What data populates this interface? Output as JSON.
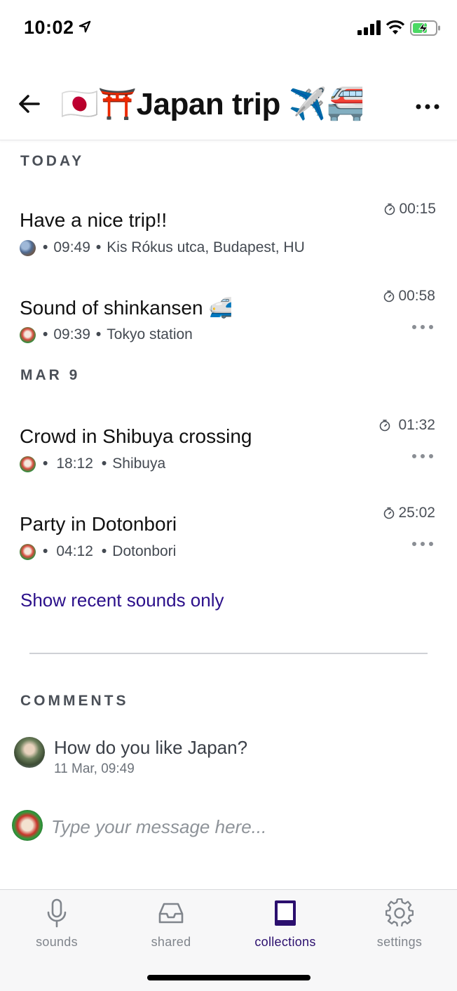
{
  "status_bar": {
    "time": "10:02",
    "battery_charging": true,
    "colors": {
      "battery_fill": "#4cd964"
    }
  },
  "header": {
    "title_flags_left": "🇯🇵⛩️",
    "title_text": "Japan trip",
    "title_flags_right": "✈️🚝",
    "back_icon": "back-arrow-icon",
    "more_icon": "more-horizontal-icon"
  },
  "sections": {
    "today_label": "TODAY",
    "mar9_label": "MAR 9",
    "comments_label": "COMMENTS"
  },
  "sounds": [
    {
      "title": "Have a nice trip!!",
      "time": "09:49",
      "location": "Kis Rókus utca, Budapest, HU",
      "duration": "00:15",
      "has_more": false
    },
    {
      "title": "Sound of shinkansen 🚅",
      "time": "09:39",
      "location": "Tokyo station",
      "duration": "00:58",
      "has_more": true
    },
    {
      "title": "Crowd in Shibuya crossing",
      "time": "18:12",
      "location": "Shibuya",
      "duration": "01:32",
      "has_more": true
    },
    {
      "title": "Party in Dotonbori",
      "time": "04:12",
      "location": "Dotonbori",
      "duration": "25:02",
      "has_more": true
    }
  ],
  "show_recent_link": "Show recent sounds only",
  "comments": [
    {
      "text": "How do you like Japan?",
      "timestamp": "11 Mar, 09:49"
    }
  ],
  "composer": {
    "placeholder": "Type your message here..."
  },
  "tabs": [
    {
      "label": "sounds",
      "icon": "microphone-icon",
      "active": false
    },
    {
      "label": "shared",
      "icon": "inbox-icon",
      "active": false
    },
    {
      "label": "collections",
      "icon": "book-icon",
      "active": true
    },
    {
      "label": "settings",
      "icon": "gear-icon",
      "active": false
    }
  ],
  "colors": {
    "accent": "#2b0f6e",
    "link": "#2b0f8a",
    "muted": "#80858c"
  }
}
